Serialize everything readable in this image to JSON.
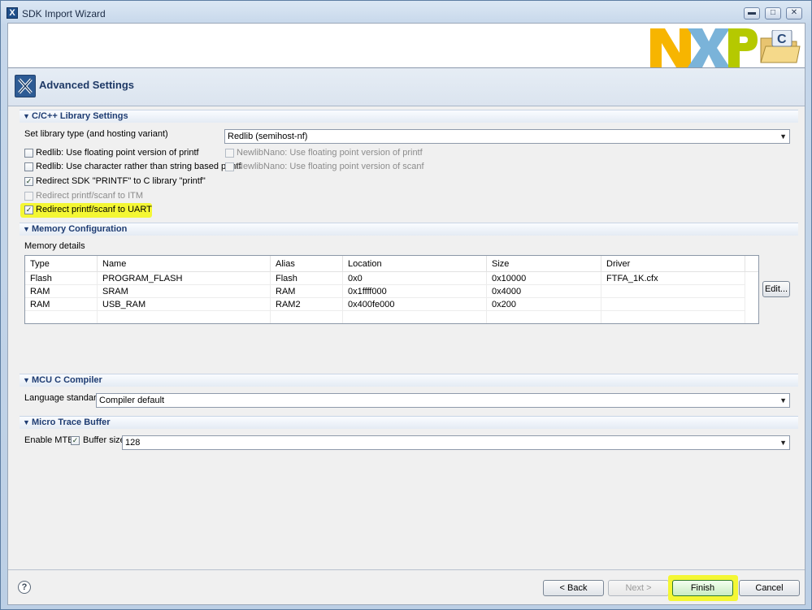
{
  "window": {
    "title": "SDK Import Wizard",
    "header_title": "Advanced Settings",
    "accent": "#1e3c72",
    "highlight": "#f4f734"
  },
  "library": {
    "section_title": "C/C++ Library Settings",
    "library_type_label": "Set library type (and hosting variant)",
    "library_type_value": "Redlib (semihost-nf)",
    "checkboxes": [
      {
        "label": "Redlib: Use floating point version of printf",
        "checked": false,
        "enabled": true
      },
      {
        "label": "Redlib: Use character rather than string based printf",
        "checked": false,
        "enabled": true
      },
      {
        "label": "Redirect SDK \"PRINTF\" to C library \"printf\"",
        "checked": true,
        "enabled": true
      },
      {
        "label": "Redirect printf/scanf to ITM",
        "checked": false,
        "enabled": false
      },
      {
        "label": "Redirect printf/scanf to UART",
        "checked": true,
        "enabled": true
      }
    ],
    "nano_checkboxes": [
      {
        "label": "NewlibNano: Use floating point version of printf",
        "checked": false,
        "enabled": false
      },
      {
        "label": "NewlibNano: Use floating point version of scanf",
        "checked": false,
        "enabled": false
      }
    ]
  },
  "memory": {
    "section_title": "Memory Configuration",
    "details_label": "Memory details",
    "columns": [
      "Type",
      "Name",
      "Alias",
      "Location",
      "Size",
      "Driver"
    ],
    "rows": [
      [
        "Flash",
        "PROGRAM_FLASH",
        "Flash",
        "0x0",
        "0x10000",
        "FTFA_1K.cfx"
      ],
      [
        "RAM",
        "SRAM",
        "RAM",
        "0x1ffff000",
        "0x4000",
        ""
      ],
      [
        "RAM",
        "USB_RAM",
        "RAM2",
        "0x400fe000",
        "0x200",
        ""
      ]
    ],
    "edit_button": "Edit..."
  },
  "compiler": {
    "section_title": "MCU C Compiler",
    "language_label": "Language standard",
    "language_value": "Compiler default"
  },
  "mtb": {
    "section_title": "Micro Trace Buffer",
    "enable_label": "Enable MTB",
    "enabled": true,
    "buffer_label": "Buffer size",
    "buffer_value": "128"
  },
  "footer": {
    "help_glyph": "?",
    "back_label": "< Back",
    "next_label": "Next >",
    "finish_label": "Finish",
    "cancel_label": "Cancel"
  },
  "icons": {
    "check": "✓",
    "triangle": "▼",
    "dropdown_arrow": "▼",
    "minimize": "▬",
    "maximize": "□",
    "close": "✕"
  }
}
